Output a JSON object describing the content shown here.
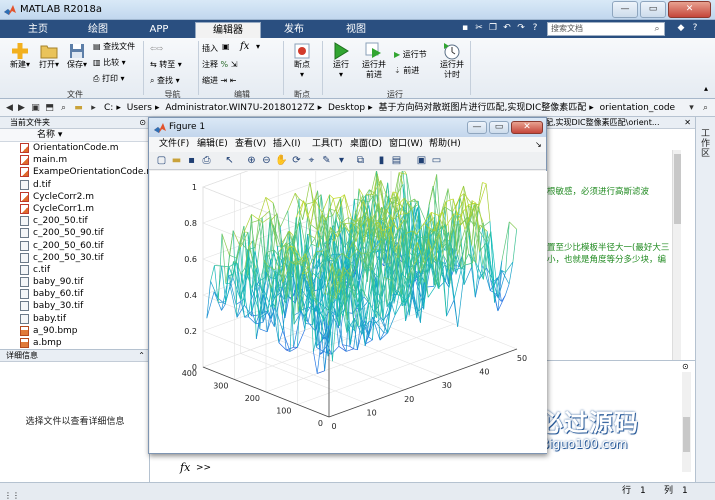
{
  "window": {
    "title": "MATLAB R2018a"
  },
  "ribbon_tabs": [
    "主页",
    "绘图",
    "APP",
    "编辑器",
    "发布",
    "视图"
  ],
  "search": {
    "placeholder": "搜索文档"
  },
  "ribbon": {
    "new": "新建",
    "open": "打开",
    "save": "保存",
    "find_files": "查找文件",
    "compare": "比较",
    "print": "打印",
    "insert": "插入",
    "fx": "fx",
    "comment": "注释",
    "indent": "缩进",
    "goto": "转至",
    "find": "查找",
    "breakpoints": "断点",
    "run": "运行",
    "run_advance_1": "运行并",
    "run_advance_2": "前进",
    "run_section": "运行节",
    "advance": "前进",
    "run_time_1": "运行并",
    "run_time_2": "计时",
    "group_file": "文件",
    "group_nav": "导航",
    "group_edit": "编辑",
    "group_bp": "断点",
    "group_run": "运行"
  },
  "address": {
    "crumbs": [
      "C:",
      "Users",
      "Administrator.WIN7U-20180127Z",
      "Desktop",
      "基于方向码对散斑图片进行匹配,实现DIC整像素匹配",
      "orientation_code"
    ]
  },
  "folder_panel": {
    "title": "当前文件夹",
    "column": "名称",
    "files": [
      {
        "name": "OrientationCode.m",
        "kind": "m"
      },
      {
        "name": "main.m",
        "kind": "m"
      },
      {
        "name": "ExampeOrientationCode.m",
        "kind": "m"
      },
      {
        "name": "d.tif",
        "kind": "img"
      },
      {
        "name": "CycleCorr2.m",
        "kind": "m"
      },
      {
        "name": "CycleCorr1.m",
        "kind": "m"
      },
      {
        "name": "c_200_50.tif",
        "kind": "img"
      },
      {
        "name": "c_200_50_90.tif",
        "kind": "img"
      },
      {
        "name": "c_200_50_60.tif",
        "kind": "img"
      },
      {
        "name": "c_200_50_30.tif",
        "kind": "img"
      },
      {
        "name": "c.tif",
        "kind": "img"
      },
      {
        "name": "baby_90.tif",
        "kind": "img"
      },
      {
        "name": "baby_60.tif",
        "kind": "img"
      },
      {
        "name": "baby_30.tif",
        "kind": "img"
      },
      {
        "name": "baby.tif",
        "kind": "img"
      },
      {
        "name": "a_90.bmp",
        "kind": "bmp"
      },
      {
        "name": "a.bmp",
        "kind": "bmp"
      }
    ]
  },
  "details_panel": {
    "title": "详细信息",
    "message": "选择文件以查看详细信息"
  },
  "editor": {
    "header_visible": "配,实现DIC整像素匹配\\orient...",
    "comment1": "根敏感，必须进行高斯滤波",
    "comment2a": "置至少比模板半径大一(最好大三",
    "comment2b": "小，也就是角度等分多少块，编"
  },
  "workspace": {
    "title": "工作区"
  },
  "command": {
    "fx": "fx",
    "prompt": ">>"
  },
  "status": {
    "row_label": "行",
    "row": "1",
    "col_label": "列",
    "col": "1"
  },
  "watermark": {
    "text": "必过源码",
    "url": "Biguo100.com"
  },
  "figure": {
    "title": "Figure 1",
    "menu": [
      "文件(F)",
      "编辑(E)",
      "查看(V)",
      "插入(I)",
      "工具(T)",
      "桌面(D)",
      "窗口(W)",
      "帮助(H)"
    ]
  },
  "colors": {
    "ribbon_tab_bar": "#2a4f80",
    "comment_green": "#228b22",
    "parula_low": "#3e26a8",
    "parula_mid": "#13beb8",
    "parula_high": "#f9fb0e"
  },
  "chart_data": {
    "type": "mesh",
    "title": "",
    "z_ticks": [
      "0",
      "0.2",
      "0.4",
      "0.6",
      "0.8",
      "1"
    ],
    "x_ticks": [
      "0",
      "10",
      "20",
      "30",
      "40",
      "50"
    ],
    "y_ticks": [
      "0",
      "100",
      "200",
      "300",
      "400"
    ],
    "xlim": [
      0,
      50
    ],
    "ylim": [
      0,
      400
    ],
    "zlim": [
      0,
      1
    ],
    "x_range": [
      1,
      50
    ],
    "y_range": [
      1,
      400
    ],
    "z_typical_range": [
      0.2,
      0.85
    ],
    "colormap": "parula",
    "grid": true
  }
}
